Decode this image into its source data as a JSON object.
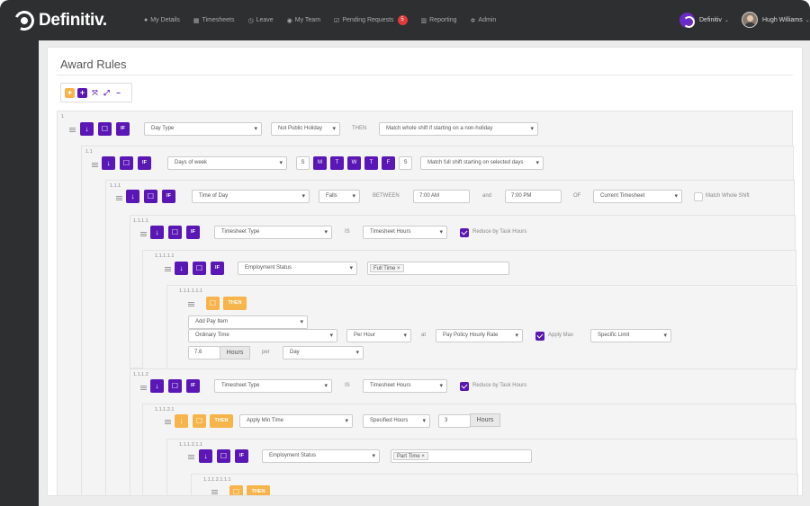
{
  "brand": {
    "name": "Definitiv."
  },
  "nav": [
    {
      "icon": "user-icon",
      "glyph": "●",
      "label": "My Details"
    },
    {
      "icon": "calendar-icon",
      "glyph": "▦",
      "label": "Timesheets"
    },
    {
      "icon": "clock-icon",
      "glyph": "◷",
      "label": "Leave"
    },
    {
      "icon": "team-icon",
      "glyph": "◉",
      "label": "My Team"
    },
    {
      "icon": "checkbox-icon",
      "glyph": "☑",
      "label": "Pending Requests",
      "badge": "5"
    },
    {
      "icon": "bar-chart-icon",
      "glyph": "▥",
      "label": "Reporting"
    },
    {
      "icon": "gear-icon",
      "glyph": "✲",
      "label": "Admin"
    }
  ],
  "org": {
    "name": "Definitiv"
  },
  "user": {
    "name": "Hugh Williams"
  },
  "page": {
    "title": "Award Rules"
  },
  "toolbar": {
    "add": "+",
    "add_child": "+",
    "expand": "⤧",
    "collapse": "⤢",
    "remove": "−"
  },
  "actions": {
    "down": "↓",
    "comment": "☐",
    "if": "IF",
    "then": "THEN"
  },
  "rules": {
    "r1": {
      "id": "1",
      "field": "Day Type",
      "value": "Not Public Holiday",
      "op": "THEN",
      "match": "Match whole shift if starting on a non-holiday"
    },
    "r11": {
      "id": "1.1",
      "field": "Days of week",
      "days": [
        "S",
        "M",
        "T",
        "W",
        "T",
        "F",
        "S"
      ],
      "match": "Match full shift starting on selected days"
    },
    "r111": {
      "id": "1.1.1",
      "field": "Time of Day",
      "op": "Falls",
      "between": "BETWEEN",
      "from": "7:00 AM",
      "and": "and",
      "to": "7:00 PM",
      "of": "OF",
      "period": "Current Timesheet",
      "match_whole": "Match Whole Shift"
    },
    "r1111": {
      "id": "1.1.1.1",
      "field": "Timesheet Type",
      "is": "IS",
      "value": "Timesheet Hours",
      "reduce": "Reduce by Task Hours"
    },
    "r11111": {
      "id": "1.1.1.1.1",
      "field": "Employment Status",
      "tag": "Full Time",
      "tag_remove": "×"
    },
    "r111111": {
      "id": "1.1.1.1.1.1",
      "then": "THEN",
      "action": "Add Pay Item",
      "pay_item": "Ordinary Time",
      "rate_type": "Per Hour",
      "at": "at",
      "rate": "Pay Policy Hourly Rate",
      "apply_max": "Apply Max",
      "limit": "Specific Limit",
      "qty": "7.6",
      "unit": "Hours",
      "per": "per",
      "period": "Day"
    },
    "r1112": {
      "id": "1.1.1.2",
      "field": "Timesheet Type",
      "is": "IS",
      "value": "Timesheet Hours",
      "reduce": "Reduce by Task Hours"
    },
    "r11121": {
      "id": "1.1.1.2.1",
      "then": "THEN",
      "action": "Apply Min Time",
      "mode": "Specified Hours",
      "qty": "3",
      "unit": "Hours"
    },
    "r111211": {
      "id": "1.1.1.2.1.1",
      "field": "Employment Status",
      "tag": "Part Time",
      "tag_remove": "×"
    },
    "r1112111": {
      "id": "1.1.1.2.1.1.1",
      "then": "THEN"
    }
  },
  "colors": {
    "accent": "#5a17b5",
    "then": "#f7b44a",
    "nav_bg": "#2e2f31",
    "badge": "#e03a3a"
  }
}
